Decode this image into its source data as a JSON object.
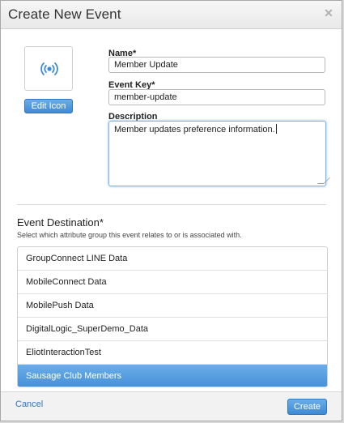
{
  "dialog": {
    "title": "Create New Event"
  },
  "icon": {
    "name": "broadcast-icon",
    "edit_label": "Edit Icon"
  },
  "form": {
    "name_label": "Name*",
    "name_value": "Member Update",
    "key_label": "Event Key*",
    "key_value": "member-update",
    "description_label": "Description",
    "description_value": "Member updates preference information."
  },
  "destination": {
    "title": "Event Destination*",
    "subtitle": "Select which attribute group this event relates to or is associated with.",
    "items": [
      "GroupConnect LINE Data",
      "MobileConnect Data",
      "MobilePush Data",
      "DigitalLogic_SuperDemo_Data",
      "EliotInteractionTest",
      "Sausage Club Members"
    ],
    "selected": "Sausage Club Members"
  },
  "footer": {
    "cancel_label": "Cancel",
    "create_label": "Create"
  },
  "colors": {
    "accent": "#4690d8",
    "link": "#2f77c2"
  }
}
